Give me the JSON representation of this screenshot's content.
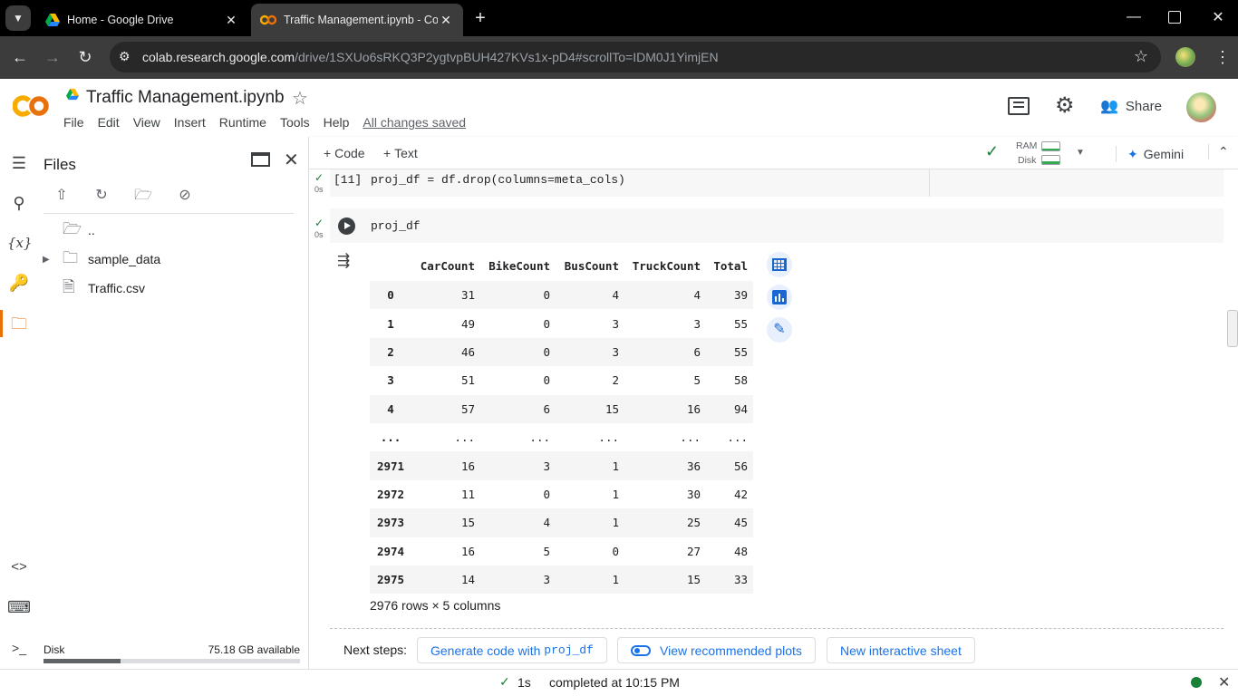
{
  "browser": {
    "tabs": [
      {
        "title": "Home - Google Drive",
        "icon": "google-drive-icon"
      },
      {
        "title": "Traffic Management.ipynb - Col",
        "icon": "colab-icon"
      }
    ],
    "url_host": "colab.research.google.com",
    "url_path": "/drive/1SXUo6sRKQ3P2ygtvpBUH427KVs1x-pD4#scrollTo=IDM0J1YimjEN"
  },
  "colab": {
    "logo": "CO",
    "notebook_title": "Traffic Management.ipynb",
    "menu": [
      "File",
      "Edit",
      "View",
      "Insert",
      "Runtime",
      "Tools",
      "Help"
    ],
    "save_status": "All changes saved",
    "share_label": "Share",
    "add_code": "Code",
    "add_text": "Text",
    "ram_label": "RAM",
    "disk_label": "Disk",
    "gemini_label": "Gemini"
  },
  "files_panel": {
    "title": "Files",
    "items": [
      {
        "name": "..",
        "type": "folder-up"
      },
      {
        "name": "sample_data",
        "type": "folder"
      },
      {
        "name": "Traffic.csv",
        "type": "file"
      }
    ],
    "disk_label": "Disk",
    "disk_available": "75.18 GB available",
    "disk_usage_fraction": 0.3
  },
  "cells": [
    {
      "exec": "[11]",
      "time": "0s",
      "code": "proj_df = df.drop(columns=meta_cols)"
    },
    {
      "exec": "",
      "time": "0s",
      "code": "proj_df"
    }
  ],
  "dataframe": {
    "columns": [
      "CarCount",
      "BikeCount",
      "BusCount",
      "TruckCount",
      "Total"
    ],
    "rows": [
      {
        "index": "0",
        "values": [
          "31",
          "0",
          "4",
          "4",
          "39"
        ]
      },
      {
        "index": "1",
        "values": [
          "49",
          "0",
          "3",
          "3",
          "55"
        ]
      },
      {
        "index": "2",
        "values": [
          "46",
          "0",
          "3",
          "6",
          "55"
        ]
      },
      {
        "index": "3",
        "values": [
          "51",
          "0",
          "2",
          "5",
          "58"
        ]
      },
      {
        "index": "4",
        "values": [
          "57",
          "6",
          "15",
          "16",
          "94"
        ]
      },
      {
        "index": "...",
        "values": [
          "...",
          "...",
          "...",
          "...",
          "..."
        ]
      },
      {
        "index": "2971",
        "values": [
          "16",
          "3",
          "1",
          "36",
          "56"
        ]
      },
      {
        "index": "2972",
        "values": [
          "11",
          "0",
          "1",
          "30",
          "42"
        ]
      },
      {
        "index": "2973",
        "values": [
          "15",
          "4",
          "1",
          "25",
          "45"
        ]
      },
      {
        "index": "2974",
        "values": [
          "16",
          "5",
          "0",
          "27",
          "48"
        ]
      },
      {
        "index": "2975",
        "values": [
          "14",
          "3",
          "1",
          "15",
          "33"
        ]
      }
    ],
    "shape": "2976 rows × 5 columns"
  },
  "next_steps": {
    "label": "Next steps:",
    "generate_prefix": "Generate code with",
    "generate_var": "proj_df",
    "recommended_plots": "View recommended plots",
    "interactive_sheet": "New interactive sheet"
  },
  "status": {
    "duration": "1s",
    "completed": "completed at 10:15 PM"
  },
  "colors": {
    "accent_blue": "#1a73e8",
    "colab_orange": "#f9ab00",
    "success_green": "#188038"
  }
}
